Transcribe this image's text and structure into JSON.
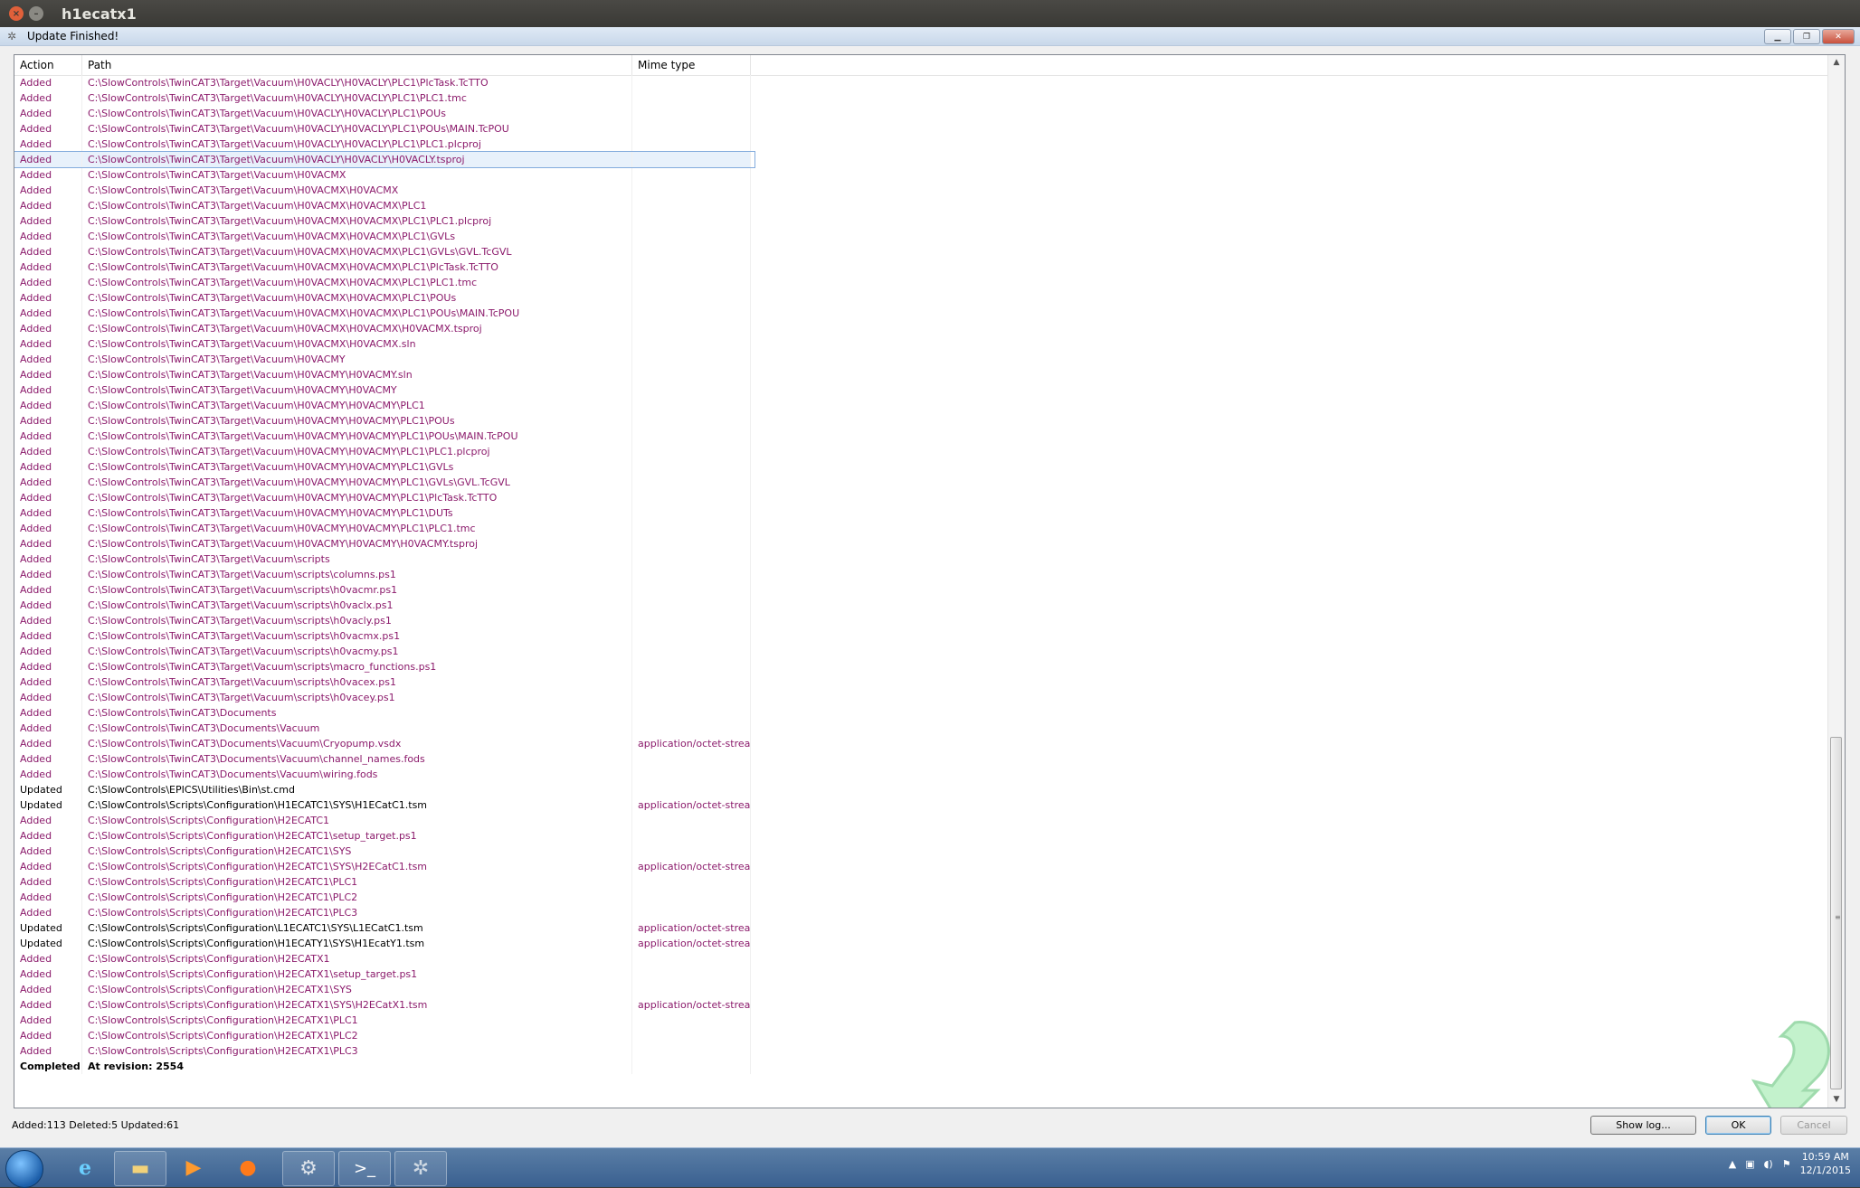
{
  "host": {
    "title": "h1ecatx1"
  },
  "window": {
    "title": "Update Finished!"
  },
  "columns": {
    "action": "Action",
    "path": "Path",
    "mime": "Mime type"
  },
  "rows": [
    {
      "action": "Added",
      "path": "C:\\SlowControls\\TwinCAT3\\Target\\Vacuum\\H0VACLY\\H0VACLY\\PLC1\\PlcTask.TcTTO",
      "mime": ""
    },
    {
      "action": "Added",
      "path": "C:\\SlowControls\\TwinCAT3\\Target\\Vacuum\\H0VACLY\\H0VACLY\\PLC1\\PLC1.tmc",
      "mime": ""
    },
    {
      "action": "Added",
      "path": "C:\\SlowControls\\TwinCAT3\\Target\\Vacuum\\H0VACLY\\H0VACLY\\PLC1\\POUs",
      "mime": ""
    },
    {
      "action": "Added",
      "path": "C:\\SlowControls\\TwinCAT3\\Target\\Vacuum\\H0VACLY\\H0VACLY\\PLC1\\POUs\\MAIN.TcPOU",
      "mime": ""
    },
    {
      "action": "Added",
      "path": "C:\\SlowControls\\TwinCAT3\\Target\\Vacuum\\H0VACLY\\H0VACLY\\PLC1\\PLC1.plcproj",
      "mime": ""
    },
    {
      "action": "Added",
      "path": "C:\\SlowControls\\TwinCAT3\\Target\\Vacuum\\H0VACLY\\H0VACLY\\H0VACLY.tsproj",
      "mime": "",
      "selected": true
    },
    {
      "action": "Added",
      "path": "C:\\SlowControls\\TwinCAT3\\Target\\Vacuum\\H0VACMX",
      "mime": ""
    },
    {
      "action": "Added",
      "path": "C:\\SlowControls\\TwinCAT3\\Target\\Vacuum\\H0VACMX\\H0VACMX",
      "mime": ""
    },
    {
      "action": "Added",
      "path": "C:\\SlowControls\\TwinCAT3\\Target\\Vacuum\\H0VACMX\\H0VACMX\\PLC1",
      "mime": ""
    },
    {
      "action": "Added",
      "path": "C:\\SlowControls\\TwinCAT3\\Target\\Vacuum\\H0VACMX\\H0VACMX\\PLC1\\PLC1.plcproj",
      "mime": ""
    },
    {
      "action": "Added",
      "path": "C:\\SlowControls\\TwinCAT3\\Target\\Vacuum\\H0VACMX\\H0VACMX\\PLC1\\GVLs",
      "mime": ""
    },
    {
      "action": "Added",
      "path": "C:\\SlowControls\\TwinCAT3\\Target\\Vacuum\\H0VACMX\\H0VACMX\\PLC1\\GVLs\\GVL.TcGVL",
      "mime": ""
    },
    {
      "action": "Added",
      "path": "C:\\SlowControls\\TwinCAT3\\Target\\Vacuum\\H0VACMX\\H0VACMX\\PLC1\\PlcTask.TcTTO",
      "mime": ""
    },
    {
      "action": "Added",
      "path": "C:\\SlowControls\\TwinCAT3\\Target\\Vacuum\\H0VACMX\\H0VACMX\\PLC1\\PLC1.tmc",
      "mime": ""
    },
    {
      "action": "Added",
      "path": "C:\\SlowControls\\TwinCAT3\\Target\\Vacuum\\H0VACMX\\H0VACMX\\PLC1\\POUs",
      "mime": ""
    },
    {
      "action": "Added",
      "path": "C:\\SlowControls\\TwinCAT3\\Target\\Vacuum\\H0VACMX\\H0VACMX\\PLC1\\POUs\\MAIN.TcPOU",
      "mime": ""
    },
    {
      "action": "Added",
      "path": "C:\\SlowControls\\TwinCAT3\\Target\\Vacuum\\H0VACMX\\H0VACMX\\H0VACMX.tsproj",
      "mime": ""
    },
    {
      "action": "Added",
      "path": "C:\\SlowControls\\TwinCAT3\\Target\\Vacuum\\H0VACMX\\H0VACMX.sln",
      "mime": ""
    },
    {
      "action": "Added",
      "path": "C:\\SlowControls\\TwinCAT3\\Target\\Vacuum\\H0VACMY",
      "mime": ""
    },
    {
      "action": "Added",
      "path": "C:\\SlowControls\\TwinCAT3\\Target\\Vacuum\\H0VACMY\\H0VACMY.sln",
      "mime": ""
    },
    {
      "action": "Added",
      "path": "C:\\SlowControls\\TwinCAT3\\Target\\Vacuum\\H0VACMY\\H0VACMY",
      "mime": ""
    },
    {
      "action": "Added",
      "path": "C:\\SlowControls\\TwinCAT3\\Target\\Vacuum\\H0VACMY\\H0VACMY\\PLC1",
      "mime": ""
    },
    {
      "action": "Added",
      "path": "C:\\SlowControls\\TwinCAT3\\Target\\Vacuum\\H0VACMY\\H0VACMY\\PLC1\\POUs",
      "mime": ""
    },
    {
      "action": "Added",
      "path": "C:\\SlowControls\\TwinCAT3\\Target\\Vacuum\\H0VACMY\\H0VACMY\\PLC1\\POUs\\MAIN.TcPOU",
      "mime": ""
    },
    {
      "action": "Added",
      "path": "C:\\SlowControls\\TwinCAT3\\Target\\Vacuum\\H0VACMY\\H0VACMY\\PLC1\\PLC1.plcproj",
      "mime": ""
    },
    {
      "action": "Added",
      "path": "C:\\SlowControls\\TwinCAT3\\Target\\Vacuum\\H0VACMY\\H0VACMY\\PLC1\\GVLs",
      "mime": ""
    },
    {
      "action": "Added",
      "path": "C:\\SlowControls\\TwinCAT3\\Target\\Vacuum\\H0VACMY\\H0VACMY\\PLC1\\GVLs\\GVL.TcGVL",
      "mime": ""
    },
    {
      "action": "Added",
      "path": "C:\\SlowControls\\TwinCAT3\\Target\\Vacuum\\H0VACMY\\H0VACMY\\PLC1\\PlcTask.TcTTO",
      "mime": ""
    },
    {
      "action": "Added",
      "path": "C:\\SlowControls\\TwinCAT3\\Target\\Vacuum\\H0VACMY\\H0VACMY\\PLC1\\DUTs",
      "mime": ""
    },
    {
      "action": "Added",
      "path": "C:\\SlowControls\\TwinCAT3\\Target\\Vacuum\\H0VACMY\\H0VACMY\\PLC1\\PLC1.tmc",
      "mime": ""
    },
    {
      "action": "Added",
      "path": "C:\\SlowControls\\TwinCAT3\\Target\\Vacuum\\H0VACMY\\H0VACMY\\H0VACMY.tsproj",
      "mime": ""
    },
    {
      "action": "Added",
      "path": "C:\\SlowControls\\TwinCAT3\\Target\\Vacuum\\scripts",
      "mime": ""
    },
    {
      "action": "Added",
      "path": "C:\\SlowControls\\TwinCAT3\\Target\\Vacuum\\scripts\\columns.ps1",
      "mime": ""
    },
    {
      "action": "Added",
      "path": "C:\\SlowControls\\TwinCAT3\\Target\\Vacuum\\scripts\\h0vacmr.ps1",
      "mime": ""
    },
    {
      "action": "Added",
      "path": "C:\\SlowControls\\TwinCAT3\\Target\\Vacuum\\scripts\\h0vaclx.ps1",
      "mime": ""
    },
    {
      "action": "Added",
      "path": "C:\\SlowControls\\TwinCAT3\\Target\\Vacuum\\scripts\\h0vacly.ps1",
      "mime": ""
    },
    {
      "action": "Added",
      "path": "C:\\SlowControls\\TwinCAT3\\Target\\Vacuum\\scripts\\h0vacmx.ps1",
      "mime": ""
    },
    {
      "action": "Added",
      "path": "C:\\SlowControls\\TwinCAT3\\Target\\Vacuum\\scripts\\h0vacmy.ps1",
      "mime": ""
    },
    {
      "action": "Added",
      "path": "C:\\SlowControls\\TwinCAT3\\Target\\Vacuum\\scripts\\macro_functions.ps1",
      "mime": ""
    },
    {
      "action": "Added",
      "path": "C:\\SlowControls\\TwinCAT3\\Target\\Vacuum\\scripts\\h0vacex.ps1",
      "mime": ""
    },
    {
      "action": "Added",
      "path": "C:\\SlowControls\\TwinCAT3\\Target\\Vacuum\\scripts\\h0vacey.ps1",
      "mime": ""
    },
    {
      "action": "Added",
      "path": "C:\\SlowControls\\TwinCAT3\\Documents",
      "mime": ""
    },
    {
      "action": "Added",
      "path": "C:\\SlowControls\\TwinCAT3\\Documents\\Vacuum",
      "mime": ""
    },
    {
      "action": "Added",
      "path": "C:\\SlowControls\\TwinCAT3\\Documents\\Vacuum\\Cryopump.vsdx",
      "mime": "application/octet-stream"
    },
    {
      "action": "Added",
      "path": "C:\\SlowControls\\TwinCAT3\\Documents\\Vacuum\\channel_names.fods",
      "mime": ""
    },
    {
      "action": "Added",
      "path": "C:\\SlowControls\\TwinCAT3\\Documents\\Vacuum\\wiring.fods",
      "mime": ""
    },
    {
      "action": "Updated",
      "path": "C:\\SlowControls\\EPICS\\Utilities\\Bin\\st.cmd",
      "mime": ""
    },
    {
      "action": "Updated",
      "path": "C:\\SlowControls\\Scripts\\Configuration\\H1ECATC1\\SYS\\H1ECatC1.tsm",
      "mime": "application/octet-stream"
    },
    {
      "action": "Added",
      "path": "C:\\SlowControls\\Scripts\\Configuration\\H2ECATC1",
      "mime": ""
    },
    {
      "action": "Added",
      "path": "C:\\SlowControls\\Scripts\\Configuration\\H2ECATC1\\setup_target.ps1",
      "mime": ""
    },
    {
      "action": "Added",
      "path": "C:\\SlowControls\\Scripts\\Configuration\\H2ECATC1\\SYS",
      "mime": ""
    },
    {
      "action": "Added",
      "path": "C:\\SlowControls\\Scripts\\Configuration\\H2ECATC1\\SYS\\H2ECatC1.tsm",
      "mime": "application/octet-stream"
    },
    {
      "action": "Added",
      "path": "C:\\SlowControls\\Scripts\\Configuration\\H2ECATC1\\PLC1",
      "mime": ""
    },
    {
      "action": "Added",
      "path": "C:\\SlowControls\\Scripts\\Configuration\\H2ECATC1\\PLC2",
      "mime": ""
    },
    {
      "action": "Added",
      "path": "C:\\SlowControls\\Scripts\\Configuration\\H2ECATC1\\PLC3",
      "mime": ""
    },
    {
      "action": "Updated",
      "path": "C:\\SlowControls\\Scripts\\Configuration\\L1ECATC1\\SYS\\L1ECatC1.tsm",
      "mime": "application/octet-stream"
    },
    {
      "action": "Updated",
      "path": "C:\\SlowControls\\Scripts\\Configuration\\H1ECATY1\\SYS\\H1EcatY1.tsm",
      "mime": "application/octet-stream"
    },
    {
      "action": "Added",
      "path": "C:\\SlowControls\\Scripts\\Configuration\\H2ECATX1",
      "mime": ""
    },
    {
      "action": "Added",
      "path": "C:\\SlowControls\\Scripts\\Configuration\\H2ECATX1\\setup_target.ps1",
      "mime": ""
    },
    {
      "action": "Added",
      "path": "C:\\SlowControls\\Scripts\\Configuration\\H2ECATX1\\SYS",
      "mime": ""
    },
    {
      "action": "Added",
      "path": "C:\\SlowControls\\Scripts\\Configuration\\H2ECATX1\\SYS\\H2ECatX1.tsm",
      "mime": "application/octet-stream"
    },
    {
      "action": "Added",
      "path": "C:\\SlowControls\\Scripts\\Configuration\\H2ECATX1\\PLC1",
      "mime": ""
    },
    {
      "action": "Added",
      "path": "C:\\SlowControls\\Scripts\\Configuration\\H2ECATX1\\PLC2",
      "mime": ""
    },
    {
      "action": "Added",
      "path": "C:\\SlowControls\\Scripts\\Configuration\\H2ECATX1\\PLC3",
      "mime": ""
    },
    {
      "action": "Completed",
      "path": "At revision: 2554",
      "mime": ""
    }
  ],
  "footer": {
    "stats": "Added:113 Deleted:5 Updated:61"
  },
  "buttons": {
    "show_log": "Show log...",
    "ok": "OK",
    "cancel": "Cancel"
  },
  "taskbar": {
    "time": "10:59 AM",
    "date": "12/1/2015"
  },
  "colors": {
    "added": "#8b1a6b",
    "updated": "#000000",
    "selection": "#e8f1fb"
  }
}
